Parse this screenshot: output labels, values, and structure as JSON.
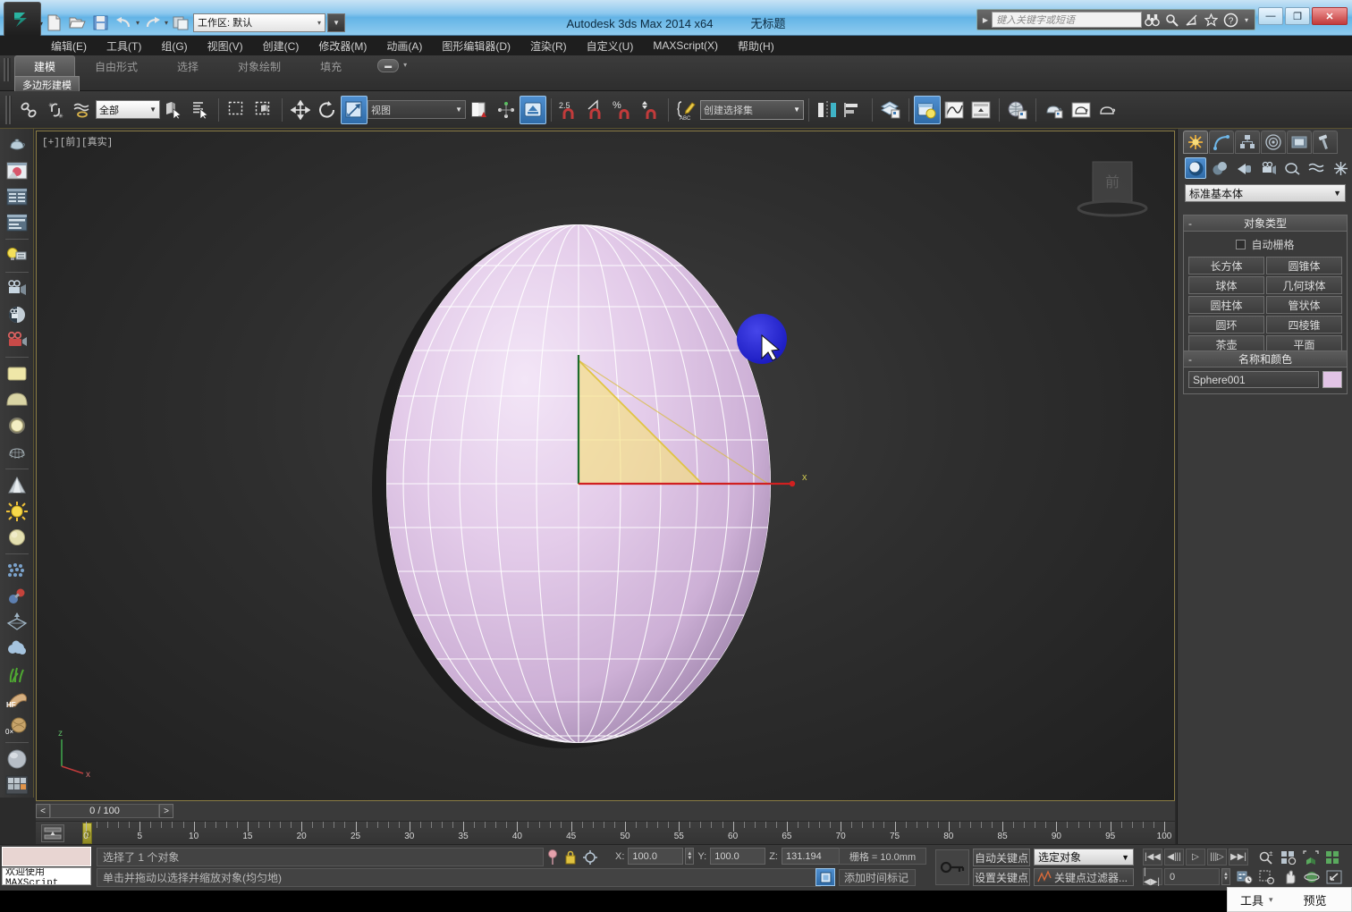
{
  "window": {
    "title": "Autodesk 3ds Max  2014 x64",
    "document": "无标题",
    "minimize_label": "—",
    "maximize_label": "❐",
    "close_label": "✕"
  },
  "quick_access": {
    "new_label": "new-file",
    "open_label": "open-file",
    "save_label": "save-file",
    "undo_label": "undo",
    "redo_label": "redo",
    "set_project_label": "set-project",
    "workspace_value": "工作区: 默认",
    "workspace_arrow": "▾",
    "workspace_drop": "▼"
  },
  "infocenter": {
    "expand_arrow": "▶",
    "placeholder": "键入关键字或短语",
    "search_label": "搜索",
    "subscription_label": "订阅中心",
    "comm_label": "通讯中心",
    "favorites_label": "收藏夹",
    "help_label": "?",
    "help_arrow": "▾"
  },
  "menu": {
    "items": [
      "编辑(E)",
      "工具(T)",
      "组(G)",
      "视图(V)",
      "创建(C)",
      "修改器(M)",
      "动画(A)",
      "图形编辑器(D)",
      "渲染(R)",
      "自定义(U)",
      "MAXScript(X)",
      "帮助(H)"
    ]
  },
  "ribbon": {
    "tabs": [
      {
        "label": "建模",
        "active": true
      },
      {
        "label": "自由形式",
        "active": false
      },
      {
        "label": "选择",
        "active": false
      },
      {
        "label": "对象绘制",
        "active": false
      },
      {
        "label": "填充",
        "active": false
      }
    ],
    "dropdown_glyph": "▬",
    "dropdown_arrow": "▾",
    "subtab": "多边形建模"
  },
  "toolbar": {
    "select_filter": "全部",
    "select_filter_arrow": "▼",
    "ref_coord_system": "视图",
    "ref_coord_arrow": "▼",
    "named_selection": "创建选择集",
    "named_selection_arrow": "▼",
    "snap_angle": "2.5",
    "snap_percent": "%",
    "icons": [
      "select-link-icon",
      "unlink-icon",
      "bind-spacewarp-icon",
      "select-object-icon",
      "select-by-name-icon",
      "rectangular-region-icon",
      "window-crossing-icon",
      "select-move-icon",
      "select-rotate-icon",
      "select-scale-icon",
      "mirror-icon",
      "align-icon",
      "use-center-icon",
      "snap-toggle-icon",
      "angle-snap-icon",
      "percent-snap-icon",
      "spinner-snap-icon",
      "edit-named-selection-icon",
      "layer-manager-icon",
      "curve-editor-icon",
      "schematic-view-icon",
      "material-editor-icon",
      "render-setup-icon",
      "rendered-frame-icon",
      "render-production-icon"
    ]
  },
  "left_toolbar": {
    "icons": [
      "teapot-primitive-icon",
      "render-preview-icon",
      "list-panel-icon",
      "layout-panel-icon",
      "light-lister-icon",
      "camera-icon",
      "camera-match-icon",
      "video-camera-icon",
      "plane-object-icon",
      "dome-object-icon",
      "sphere-glow-icon",
      "wire-teapot-icon",
      "cone-object-icon",
      "sun-light-icon",
      "sphere-light-icon",
      "particle-array-icon",
      "atom-icon",
      "deflector-icon",
      "cloud-icon",
      "grass-icon",
      "hair-fur-icon",
      "zero-icon",
      "sphere-gray-icon",
      "material-library-icon"
    ]
  },
  "viewport": {
    "label": "[+][前][真实]",
    "viewcube_label": "前",
    "object_color": "#e0c6e8",
    "gizmo_x_color": "#d02020",
    "gizmo_y_color": "#1d6b2c",
    "gizmo_box_color": "#f2d14a",
    "cursor_circle_color": "#2020d0",
    "axis_x_label": "x",
    "axis_tripod_z": "z",
    "axis_tripod_x": "x"
  },
  "command_panel": {
    "tabs": [
      {
        "name": "create-tab",
        "glyph": "✸",
        "active": true
      },
      {
        "name": "modify-tab",
        "glyph": "◜",
        "active": false
      },
      {
        "name": "hierarchy-tab",
        "glyph": "⛭",
        "active": false
      },
      {
        "name": "motion-tab",
        "glyph": "◎",
        "active": false
      },
      {
        "name": "display-tab",
        "glyph": "▣",
        "active": false
      },
      {
        "name": "utilities-tab",
        "glyph": "🔨",
        "active": false
      }
    ],
    "subcategories": [
      {
        "name": "geometry-icon",
        "active": true
      },
      {
        "name": "shapes-icon",
        "active": false
      },
      {
        "name": "lights-icon",
        "active": false
      },
      {
        "name": "cameras-icon",
        "active": false
      },
      {
        "name": "helpers-icon",
        "active": false
      },
      {
        "name": "spacewarps-icon",
        "active": false
      },
      {
        "name": "systems-icon",
        "active": false
      }
    ],
    "category": "标准基本体",
    "category_arrow": "▼",
    "object_type": {
      "title": "对象类型",
      "collapse": "-",
      "autogrid_label": "自动栅格",
      "autogrid_checked": false,
      "buttons": [
        "长方体",
        "圆锥体",
        "球体",
        "几何球体",
        "圆柱体",
        "管状体",
        "圆环",
        "四棱锥",
        "茶壶",
        "平面"
      ]
    },
    "name_and_color": {
      "title": "名称和颜色",
      "collapse": "-",
      "object_name": "Sphere001",
      "color": "#e2c4e6"
    }
  },
  "timeline": {
    "prev_arrow": "<",
    "next_arrow": ">",
    "frame_display": "0 / 100",
    "current_frame": "0",
    "ruler_min": 0,
    "ruler_max": 100,
    "ruler_labels": [
      0,
      5,
      10,
      15,
      20,
      25,
      30,
      35,
      40,
      45,
      50,
      55,
      60,
      65,
      70,
      75,
      80,
      85,
      90,
      95,
      100
    ],
    "track_button": "open-track-bar-icon"
  },
  "status_bar": {
    "maxscript_prompt": "欢迎使用 MAXScript",
    "selection_status": "选择了 1 个对象",
    "prompt_line": "单击并拖动以选择并缩放对象(均匀地)",
    "pin_icon": "pin-stack-icon",
    "lock_icon": "selection-lock-icon",
    "transform_icon": "absolute-mode-icon",
    "coords": [
      {
        "label": "X:",
        "value": "100.0"
      },
      {
        "label": "Y:",
        "value": "100.0"
      },
      {
        "label": "Z:",
        "value": "131.194"
      }
    ],
    "grid_info": "栅格 = 10.0mm",
    "add_time_tag": "添加时间标记",
    "time_tag_icon": "time-tag-icon"
  },
  "animation": {
    "key_mode_icon": "key-mode-icon",
    "auto_key": "自动关键点",
    "set_key": "设置关键点",
    "selection_list": "选定对象",
    "selection_list_arrow": "▼",
    "key_filters": "关键点过滤器...",
    "key_filters_icon": "curve-filter-icon",
    "playback": [
      {
        "name": "go-to-start-button",
        "glyph": "|◀◀"
      },
      {
        "name": "previous-frame-button",
        "glyph": "◀|||"
      },
      {
        "name": "play-animation-button",
        "glyph": "▷"
      },
      {
        "name": "next-frame-button",
        "glyph": "|||▷"
      },
      {
        "name": "go-to-end-button",
        "glyph": "▶▶|"
      }
    ],
    "key_mode_toggle": "|◀▶|",
    "frame_field": "0",
    "nav_icons_row1": [
      "zoom-icon",
      "zoom-all-icon",
      "zoom-extents-icon",
      "zoom-extents-all-icon"
    ],
    "nav_icons_row2": [
      "time-config-icon",
      "zoom-region-icon",
      "pan-icon",
      "orbit-icon",
      "maximize-viewport-icon"
    ]
  },
  "taskbar": {
    "tools_label": "工具",
    "tools_arrow": "▾",
    "preview_label": "预览"
  }
}
